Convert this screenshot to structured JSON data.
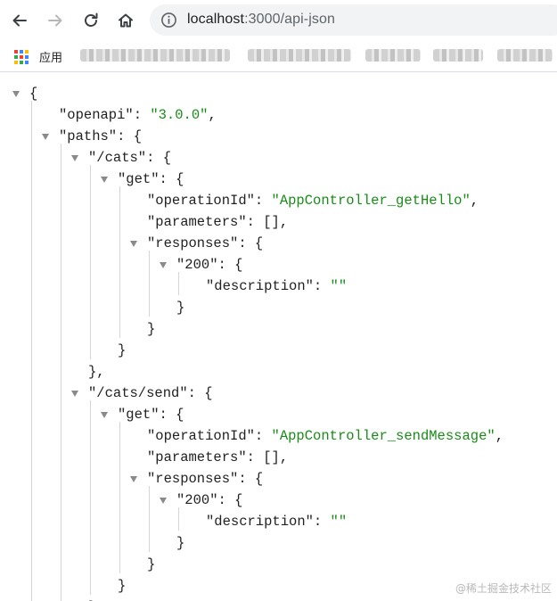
{
  "browser": {
    "url_host": "localhost",
    "url_path": ":3000/api-json",
    "bookmarks_apps_label": "应用"
  },
  "json_lines": [
    {
      "indent": 0,
      "tri": true,
      "parts": [
        [
          "punc",
          "{"
        ]
      ]
    },
    {
      "indent": 1,
      "tri": false,
      "parts": [
        [
          "key",
          "\"openapi\""
        ],
        [
          "punc",
          ": "
        ],
        [
          "str",
          "\"3.0.0\""
        ],
        [
          "punc",
          ","
        ]
      ]
    },
    {
      "indent": 1,
      "tri": true,
      "parts": [
        [
          "key",
          "\"paths\""
        ],
        [
          "punc",
          ": {"
        ]
      ]
    },
    {
      "indent": 2,
      "tri": true,
      "parts": [
        [
          "key",
          "\"/cats\""
        ],
        [
          "punc",
          ": {"
        ]
      ]
    },
    {
      "indent": 3,
      "tri": true,
      "parts": [
        [
          "key",
          "\"get\""
        ],
        [
          "punc",
          ": {"
        ]
      ]
    },
    {
      "indent": 4,
      "tri": false,
      "parts": [
        [
          "key",
          "\"operationId\""
        ],
        [
          "punc",
          ": "
        ],
        [
          "str",
          "\"AppController_getHello\""
        ],
        [
          "punc",
          ","
        ]
      ]
    },
    {
      "indent": 4,
      "tri": false,
      "parts": [
        [
          "key",
          "\"parameters\""
        ],
        [
          "punc",
          ": [],"
        ]
      ]
    },
    {
      "indent": 4,
      "tri": true,
      "parts": [
        [
          "key",
          "\"responses\""
        ],
        [
          "punc",
          ": {"
        ]
      ]
    },
    {
      "indent": 5,
      "tri": true,
      "parts": [
        [
          "key",
          "\"200\""
        ],
        [
          "punc",
          ": {"
        ]
      ]
    },
    {
      "indent": 6,
      "tri": false,
      "parts": [
        [
          "key",
          "\"description\""
        ],
        [
          "punc",
          ": "
        ],
        [
          "str",
          "\"\""
        ]
      ]
    },
    {
      "indent": 5,
      "tri": false,
      "parts": [
        [
          "punc",
          "}"
        ]
      ]
    },
    {
      "indent": 4,
      "tri": false,
      "parts": [
        [
          "punc",
          "}"
        ]
      ]
    },
    {
      "indent": 3,
      "tri": false,
      "parts": [
        [
          "punc",
          "}"
        ]
      ]
    },
    {
      "indent": 2,
      "tri": false,
      "parts": [
        [
          "punc",
          "},"
        ]
      ]
    },
    {
      "indent": 2,
      "tri": true,
      "parts": [
        [
          "key",
          "\"/cats/send\""
        ],
        [
          "punc",
          ": {"
        ]
      ]
    },
    {
      "indent": 3,
      "tri": true,
      "parts": [
        [
          "key",
          "\"get\""
        ],
        [
          "punc",
          ": {"
        ]
      ]
    },
    {
      "indent": 4,
      "tri": false,
      "parts": [
        [
          "key",
          "\"operationId\""
        ],
        [
          "punc",
          ": "
        ],
        [
          "str",
          "\"AppController_sendMessage\""
        ],
        [
          "punc",
          ","
        ]
      ]
    },
    {
      "indent": 4,
      "tri": false,
      "parts": [
        [
          "key",
          "\"parameters\""
        ],
        [
          "punc",
          ": [],"
        ]
      ]
    },
    {
      "indent": 4,
      "tri": true,
      "parts": [
        [
          "key",
          "\"responses\""
        ],
        [
          "punc",
          ": {"
        ]
      ]
    },
    {
      "indent": 5,
      "tri": true,
      "parts": [
        [
          "key",
          "\"200\""
        ],
        [
          "punc",
          ": {"
        ]
      ]
    },
    {
      "indent": 6,
      "tri": false,
      "parts": [
        [
          "key",
          "\"description\""
        ],
        [
          "punc",
          ": "
        ],
        [
          "str",
          "\"\""
        ]
      ]
    },
    {
      "indent": 5,
      "tri": false,
      "parts": [
        [
          "punc",
          "}"
        ]
      ]
    },
    {
      "indent": 4,
      "tri": false,
      "parts": [
        [
          "punc",
          "}"
        ]
      ]
    },
    {
      "indent": 3,
      "tri": false,
      "parts": [
        [
          "punc",
          "}"
        ]
      ]
    },
    {
      "indent": 2,
      "tri": false,
      "parts": [
        [
          "punc",
          "},"
        ]
      ]
    }
  ],
  "watermark": "@稀土掘金技术社区"
}
